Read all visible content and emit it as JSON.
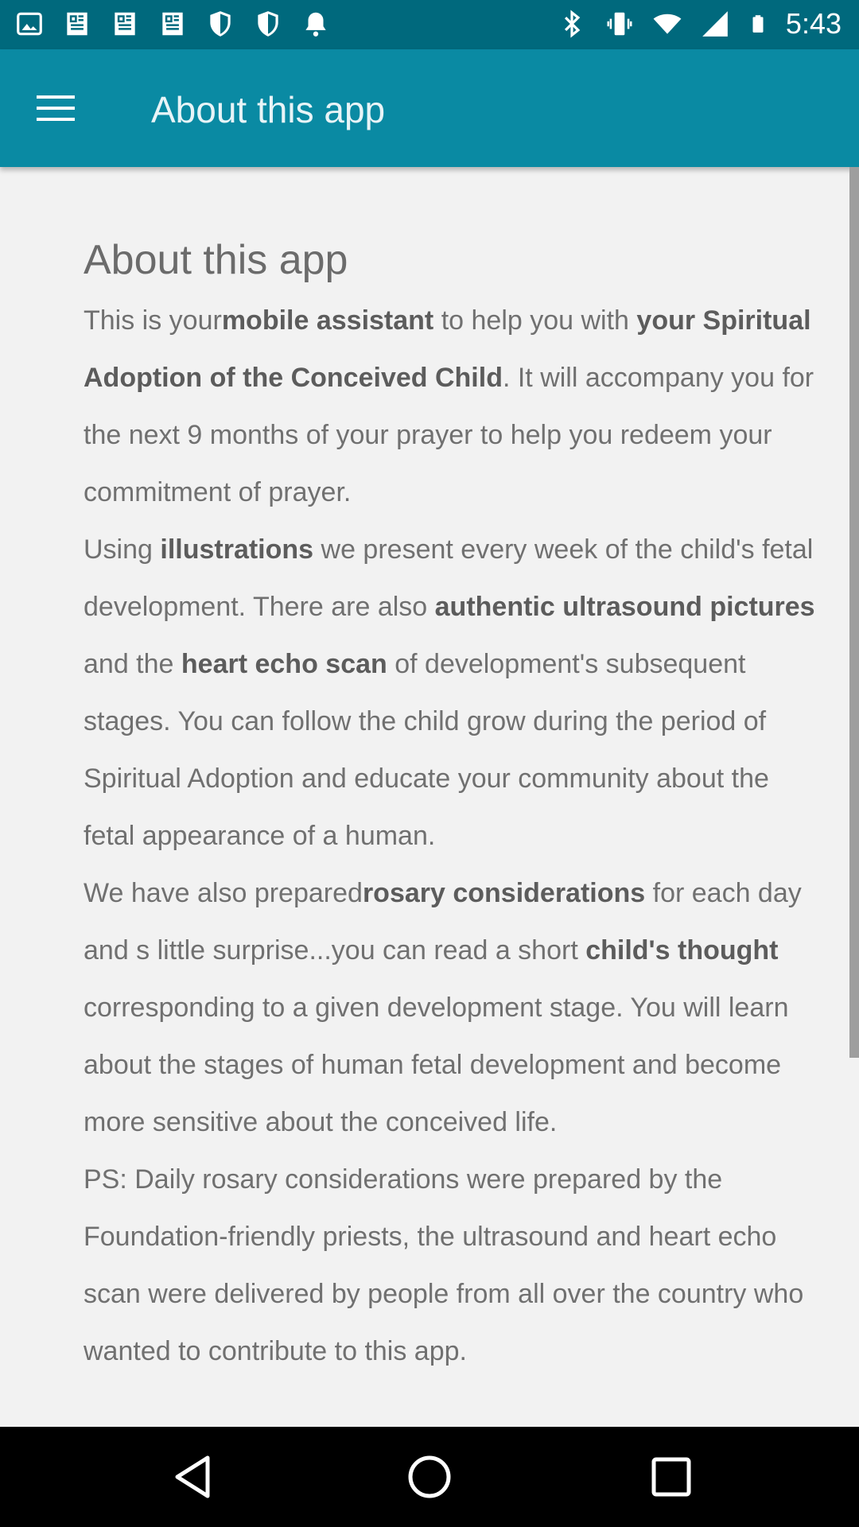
{
  "status_bar": {
    "time": "5:43",
    "left_icons": [
      "photo-icon",
      "news-icon",
      "news-icon",
      "news-icon",
      "shield-icon",
      "shield-icon",
      "bell-icon"
    ],
    "right_icons": [
      "bluetooth-icon",
      "vibrate-icon",
      "wifi-icon",
      "signal-icon",
      "battery-icon"
    ]
  },
  "app_bar": {
    "menu_icon": "hamburger-menu-icon",
    "title": "About this app",
    "color": "#0a8aa3"
  },
  "content": {
    "title": "About this app",
    "paragraphs": [
      [
        {
          "t": "This is your",
          "b": false
        },
        {
          "t": "mobile assistant",
          "b": true
        },
        {
          "t": " to help you with ",
          "b": false
        },
        {
          "t": "your Spiritual Adoption of the Conceived Child",
          "b": true
        },
        {
          "t": ". It will accompany you for the next 9 months of your prayer to help you redeem your commitment of prayer.",
          "b": false
        }
      ],
      [
        {
          "t": "Using ",
          "b": false
        },
        {
          "t": "illustrations",
          "b": true
        },
        {
          "t": " we present every week of the child's fetal development. There are also ",
          "b": false
        },
        {
          "t": "authentic ultrasound pictures",
          "b": true
        },
        {
          "t": " and the ",
          "b": false
        },
        {
          "t": "heart echo scan",
          "b": true
        },
        {
          "t": " of development's subsequent stages. You can follow the child grow during the period of Spiritual Adoption and educate your community about the fetal appearance of a human.",
          "b": false
        }
      ],
      [
        {
          "t": "We have also prepared",
          "b": false
        },
        {
          "t": "rosary considerations",
          "b": true
        },
        {
          "t": " for each day and s little surprise...you can read a short ",
          "b": false
        },
        {
          "t": "child's thought",
          "b": true
        },
        {
          "t": " corresponding to a given development stage. You will learn about the stages of human fetal development and become more sensitive about the conceived life.",
          "b": false
        }
      ],
      [
        {
          "t": "PS: Daily rosary considerations were prepared by the Foundation-friendly priests, the ultrasound and heart echo scan were delivered by people from all over the country who wanted to contribute to this app.",
          "b": false
        }
      ]
    ]
  },
  "nav_bar": {
    "back_icon": "back-triangle-icon",
    "home_icon": "home-circle-icon",
    "recents_icon": "recents-square-icon"
  }
}
